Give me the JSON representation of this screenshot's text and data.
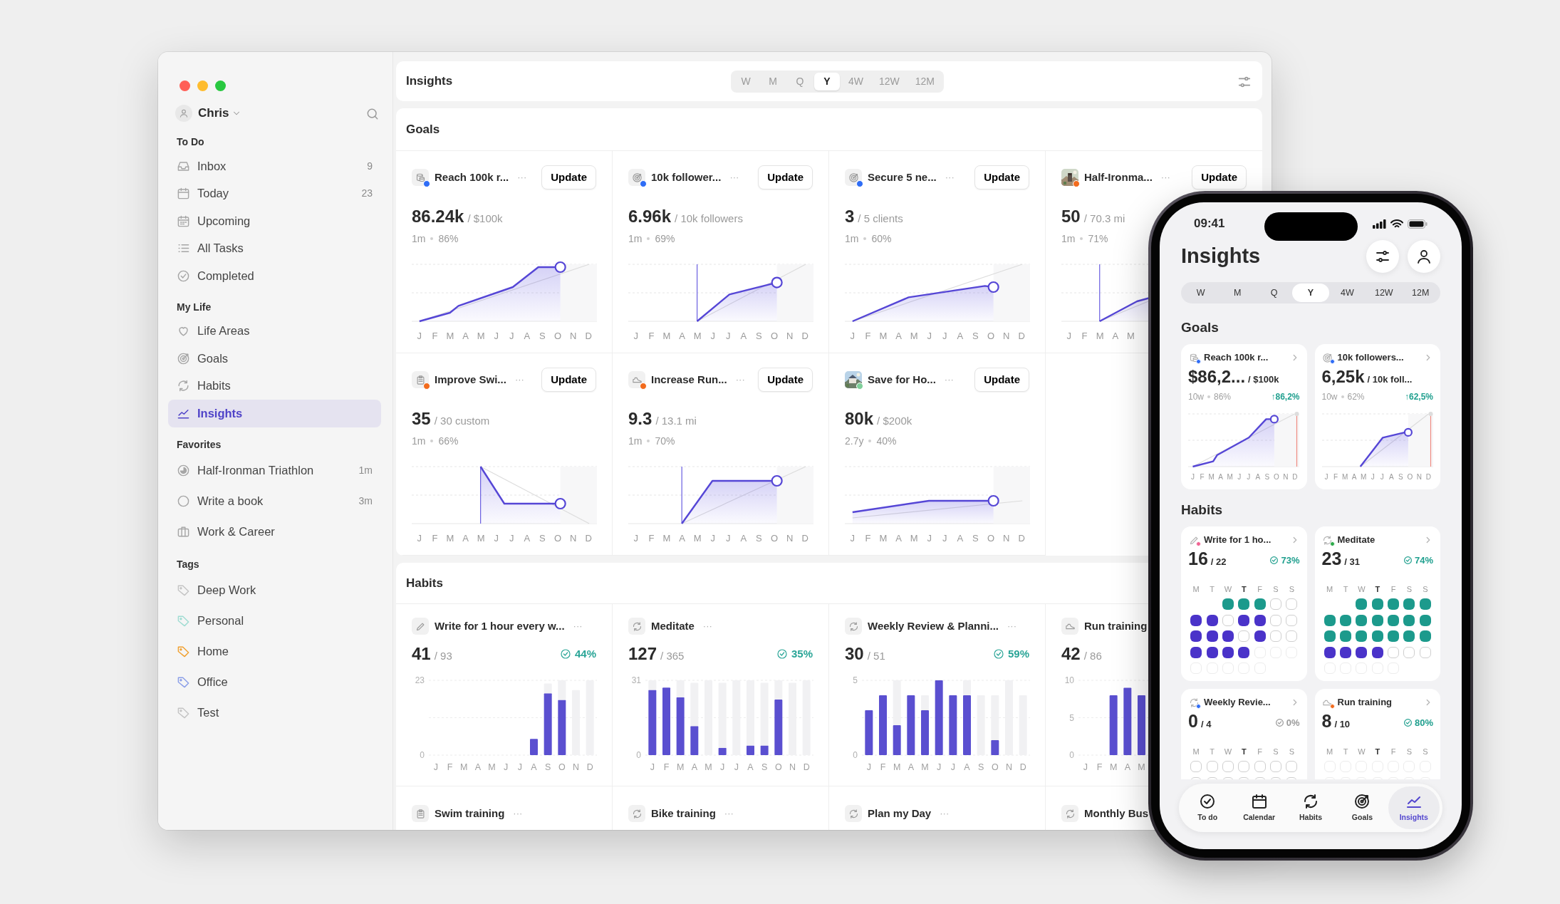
{
  "window": {
    "controls": [
      {
        "color": "#ff5f57"
      },
      {
        "color": "#febc2e"
      },
      {
        "color": "#28c840"
      }
    ]
  },
  "sidebar": {
    "user": {
      "name": "Chris"
    },
    "sections": [
      {
        "title": "To Do",
        "items": [
          {
            "label": "Inbox",
            "count": "9",
            "selected": false
          },
          {
            "label": "Today",
            "count": "23",
            "selected": false
          },
          {
            "label": "Upcoming",
            "selected": false
          },
          {
            "label": "All Tasks",
            "selected": false
          },
          {
            "label": "Completed",
            "selected": false
          }
        ]
      },
      {
        "title": "My Life",
        "items": [
          {
            "label": "Life Areas",
            "selected": false
          },
          {
            "label": "Goals",
            "selected": false
          },
          {
            "label": "Habits",
            "selected": false
          },
          {
            "label": "Insights",
            "selected": true
          }
        ]
      },
      {
        "title": "Favorites",
        "items": [
          {
            "label": "Half-Ironman Triathlon",
            "count": "1m",
            "selected": false
          },
          {
            "label": "Write a book",
            "count": "3m",
            "selected": false
          },
          {
            "label": "Work & Career",
            "selected": false
          }
        ]
      },
      {
        "title": "Tags",
        "items": [
          {
            "label": "Deep Work",
            "color": "#c4c4c4",
            "selected": false
          },
          {
            "label": "Personal",
            "color": "#9fdcd2",
            "selected": false
          },
          {
            "label": "Home",
            "color": "#f0a030",
            "selected": false
          },
          {
            "label": "Office",
            "color": "#8a9ee8",
            "selected": false
          },
          {
            "label": "Test",
            "color": "#c4c4c4",
            "selected": false
          }
        ]
      }
    ]
  },
  "toolbar": {
    "title": "Insights",
    "periods": [
      {
        "label": "W",
        "selected": false
      },
      {
        "label": "M",
        "selected": false
      },
      {
        "label": "Q",
        "selected": false
      },
      {
        "label": "Y",
        "selected": true
      },
      {
        "label": "4W",
        "selected": false
      },
      {
        "label": "12W",
        "selected": false
      },
      {
        "label": "12M",
        "selected": false
      }
    ]
  },
  "goals": {
    "title": "Goals",
    "cards": [
      {
        "title": "Reach 100k r...",
        "color": "#2f6df6",
        "more": "···",
        "button": "Update",
        "value": "86.24k",
        "target": "/ $100k",
        "meta": [
          "1m",
          "86%"
        ],
        "months": [
          "J",
          "F",
          "M",
          "A",
          "M",
          "J",
          "J",
          "A",
          "S",
          "O",
          "N",
          "D"
        ]
      },
      {
        "title": "10k follower...",
        "color": "#2f6df6",
        "more": "···",
        "button": "Update",
        "value": "6.96k",
        "target": "/ 10k followers",
        "meta": [
          "1m",
          "69%"
        ],
        "months": [
          "J",
          "F",
          "M",
          "A",
          "M",
          "J",
          "J",
          "A",
          "S",
          "O",
          "N",
          "D"
        ]
      },
      {
        "title": "Secure 5 ne...",
        "color": "#2f6df6",
        "more": "···",
        "button": "Update",
        "value": "3",
        "target": "/ 5 clients",
        "meta": [
          "1m",
          "60%"
        ],
        "months": [
          "J",
          "F",
          "M",
          "A",
          "M",
          "J",
          "J",
          "A",
          "S",
          "O",
          "N",
          "D"
        ]
      },
      {
        "title": "Half-Ironma...",
        "color": "#f26b1d",
        "more": "···",
        "button": "Update",
        "value": "50",
        "target": "/ 70.3 mi",
        "meta": [
          "1m",
          "71%"
        ],
        "months": [
          "J",
          "F",
          "M",
          "A",
          "M"
        ]
      },
      {
        "title": "Improve Swi...",
        "color": "#f26b1d",
        "more": "···",
        "button": "Update",
        "value": "35",
        "target": "/ 30 custom",
        "meta": [
          "1m",
          "66%"
        ],
        "months": [
          "J",
          "F",
          "M",
          "A",
          "M",
          "J",
          "J",
          "A",
          "S",
          "O",
          "N",
          "D"
        ]
      },
      {
        "title": "Increase Run...",
        "color": "#f26b1d",
        "more": "···",
        "button": "Update",
        "value": "9.3",
        "target": "/ 13.1 mi",
        "meta": [
          "1m",
          "70%"
        ],
        "months": [
          "J",
          "F",
          "M",
          "A",
          "M",
          "J",
          "J",
          "A",
          "S",
          "O",
          "N",
          "D"
        ]
      },
      {
        "title": "Save for Ho...",
        "color": "#7fcf9a",
        "more": "···",
        "button": "Update",
        "value": "80k",
        "target": "/ $200k",
        "meta": [
          "2.7y",
          "40%"
        ],
        "months": [
          "J",
          "F",
          "M",
          "A",
          "M",
          "J",
          "J",
          "A",
          "S",
          "O",
          "N",
          "D"
        ]
      }
    ]
  },
  "habits": {
    "title": "Habits",
    "cards": [
      {
        "kind": "chart",
        "title": "Write for 1 hour every w...",
        "more": "···",
        "value": "41",
        "target": "/ 93",
        "percent": "44%",
        "chart_data": {
          "type": "bar",
          "categories": [
            "J",
            "F",
            "M",
            "A",
            "M",
            "J",
            "J",
            "A",
            "S",
            "O",
            "N",
            "D"
          ],
          "stacked": true,
          "series": [
            {
              "color": "#5a4fd0",
              "values": [
                0,
                0,
                0,
                0,
                0,
                0,
                0,
                5,
                19,
                17,
                0,
                0
              ]
            },
            {
              "color": "#f1f1f3",
              "values": [
                null,
                null,
                null,
                null,
                null,
                null,
                null,
                null,
                3,
                6,
                20,
                23
              ]
            }
          ],
          "ylim": [
            0,
            23
          ],
          "yticks": [
            0,
            23
          ]
        }
      },
      {
        "kind": "chart",
        "title": "Meditate",
        "more": "···",
        "value": "127",
        "target": "/ 365",
        "percent": "35%",
        "chart_data": {
          "type": "bar",
          "categories": [
            "J",
            "F",
            "M",
            "A",
            "M",
            "J",
            "J",
            "A",
            "S",
            "O",
            "N",
            "D"
          ],
          "stacked": true,
          "series": [
            {
              "color": "#5a4fd0",
              "values": [
                27,
                28,
                24,
                12,
                0,
                3,
                0,
                4,
                4,
                23,
                0,
                0
              ]
            },
            {
              "color": "#f1f1f3",
              "values": [
                4,
                null,
                7,
                18,
                31,
                27,
                31,
                27,
                26,
                8,
                30,
                31
              ]
            }
          ],
          "ylim": [
            0,
            31
          ],
          "yticks": [
            0,
            31
          ]
        }
      },
      {
        "kind": "chart",
        "title": "Weekly Review & Planni...",
        "more": "···",
        "value": "30",
        "target": "/ 51",
        "percent": "59%",
        "chart_data": {
          "type": "bar",
          "categories": [
            "J",
            "F",
            "M",
            "A",
            "M",
            "J",
            "J",
            "A",
            "S",
            "O",
            "N",
            "D"
          ],
          "stacked": true,
          "series": [
            {
              "color": "#5a4fd0",
              "values": [
                3,
                4,
                2,
                4,
                3,
                5,
                4,
                4,
                0,
                1,
                0,
                0
              ]
            },
            {
              "color": "#f1f1f3",
              "values": [
                null,
                null,
                3,
                null,
                1,
                null,
                null,
                1,
                4,
                3,
                5,
                4
              ]
            }
          ],
          "ylim": [
            0,
            5
          ],
          "yticks": [
            0,
            5
          ]
        }
      },
      {
        "kind": "chart",
        "title": "Run training",
        "value": "42",
        "target": "/ 86",
        "chart_data": {
          "type": "bar",
          "categories": [
            "J",
            "F",
            "M",
            "A",
            "M"
          ],
          "series": [
            {
              "color": "#5a4fd0",
              "values": [
                0,
                0,
                8,
                9,
                8
              ]
            }
          ],
          "ylim": [
            0,
            10
          ],
          "yticks": [
            0,
            5,
            10
          ]
        }
      },
      {
        "kind": "title_only",
        "title": "Swim training",
        "more": "···"
      },
      {
        "kind": "title_only",
        "title": "Bike training",
        "more": "···"
      },
      {
        "kind": "title_only",
        "title": "Plan my Day",
        "more": "···"
      },
      {
        "kind": "title_only",
        "title": "Monthly Bus"
      }
    ]
  },
  "phone": {
    "status": {
      "time": "09:41"
    },
    "title": "Insights",
    "periods": [
      {
        "label": "W",
        "selected": false
      },
      {
        "label": "M",
        "selected": false
      },
      {
        "label": "Q",
        "selected": false
      },
      {
        "label": "Y",
        "selected": true
      },
      {
        "label": "4W",
        "selected": false
      },
      {
        "label": "12W",
        "selected": false
      },
      {
        "label": "12M",
        "selected": false
      }
    ],
    "goals": {
      "title": "Goals",
      "cards": [
        {
          "title": "Reach 100k r...",
          "color": "#2f6df6",
          "value": "$86,2...",
          "target": "/ $100k",
          "meta": [
            "10w",
            "86%"
          ],
          "change": "↑86,2%",
          "months": [
            "J",
            "F",
            "M",
            "A",
            "M",
            "J",
            "J",
            "A",
            "S",
            "O",
            "N",
            "D"
          ]
        },
        {
          "title": "10k followers...",
          "color": "#2f6df6",
          "value": "6,25k",
          "target": "/ 10k foll...",
          "meta": [
            "10w",
            "62%"
          ],
          "change": "↑62,5%",
          "months": [
            "J",
            "F",
            "M",
            "A",
            "M",
            "J",
            "J",
            "A",
            "S",
            "O",
            "N",
            "D"
          ]
        }
      ]
    },
    "habits": {
      "title": "Habits",
      "cards": [
        {
          "title": "Write for 1 ho...",
          "color": "#f06292",
          "value": "16",
          "target": "/ 22",
          "percent": "73%",
          "positive": true,
          "days": [
            {
              "label": "M",
              "today": false
            },
            {
              "label": "T",
              "today": false
            },
            {
              "label": "W",
              "today": false
            },
            {
              "label": "T",
              "today": true
            },
            {
              "label": "F",
              "today": false
            },
            {
              "label": "S",
              "today": false
            },
            {
              "label": "S",
              "today": false
            }
          ],
          "cells": [
            [
              {
                "kind": "blank"
              },
              {
                "kind": "blank"
              },
              {
                "kind": "done"
              },
              {
                "kind": "done"
              },
              {
                "kind": "done"
              },
              {
                "kind": "open"
              },
              {
                "kind": "open"
              }
            ],
            [
              {
                "kind": "current"
              },
              {
                "kind": "current"
              },
              {
                "kind": "open"
              },
              {
                "kind": "current"
              },
              {
                "kind": "current"
              },
              {
                "kind": "open"
              },
              {
                "kind": "open"
              }
            ],
            [
              {
                "kind": "current"
              },
              {
                "kind": "current"
              },
              {
                "kind": "current"
              },
              {
                "kind": "open"
              },
              {
                "kind": "current"
              },
              {
                "kind": "open"
              },
              {
                "kind": "open"
              }
            ],
            [
              {
                "kind": "current"
              },
              {
                "kind": "current"
              },
              {
                "kind": "current"
              },
              {
                "kind": "current"
              },
              {
                "kind": "faint"
              },
              {
                "kind": "faint"
              },
              {
                "kind": "faint"
              }
            ],
            [
              {
                "kind": "faint"
              },
              {
                "kind": "faint"
              },
              {
                "kind": "faint"
              },
              {
                "kind": "faint"
              },
              {
                "kind": "faint"
              }
            ]
          ]
        },
        {
          "title": "Meditate",
          "color": "#2eaa4a",
          "value": "23",
          "target": "/ 31",
          "percent": "74%",
          "positive": true,
          "days": [
            {
              "label": "M",
              "today": false
            },
            {
              "label": "T",
              "today": false
            },
            {
              "label": "W",
              "today": false
            },
            {
              "label": "T",
              "today": true
            },
            {
              "label": "F",
              "today": false
            },
            {
              "label": "S",
              "today": false
            },
            {
              "label": "S",
              "today": false
            }
          ],
          "cells": [
            [
              {
                "kind": "blank"
              },
              {
                "kind": "blank"
              },
              {
                "kind": "done"
              },
              {
                "kind": "done"
              },
              {
                "kind": "done"
              },
              {
                "kind": "done"
              },
              {
                "kind": "done"
              }
            ],
            [
              {
                "kind": "done"
              },
              {
                "kind": "done"
              },
              {
                "kind": "done"
              },
              {
                "kind": "done"
              },
              {
                "kind": "done"
              },
              {
                "kind": "done"
              },
              {
                "kind": "done"
              }
            ],
            [
              {
                "kind": "done"
              },
              {
                "kind": "done"
              },
              {
                "kind": "done"
              },
              {
                "kind": "done"
              },
              {
                "kind": "done"
              },
              {
                "kind": "done"
              },
              {
                "kind": "done"
              }
            ],
            [
              {
                "kind": "current"
              },
              {
                "kind": "current"
              },
              {
                "kind": "current"
              },
              {
                "kind": "current"
              },
              {
                "kind": "open"
              },
              {
                "kind": "open"
              },
              {
                "kind": "open"
              }
            ],
            [
              {
                "kind": "faint"
              },
              {
                "kind": "faint"
              },
              {
                "kind": "faint"
              },
              {
                "kind": "faint"
              },
              {
                "kind": "faint"
              }
            ]
          ]
        },
        {
          "title": "Weekly Revie...",
          "color": "#2f6df6",
          "value": "0",
          "target": "/ 4",
          "percent": "0%",
          "positive": false,
          "days": [
            {
              "label": "M",
              "today": false
            },
            {
              "label": "T",
              "today": false
            },
            {
              "label": "W",
              "today": false
            },
            {
              "label": "T",
              "today": true
            },
            {
              "label": "F",
              "today": false
            },
            {
              "label": "S",
              "today": false
            },
            {
              "label": "S",
              "today": false
            }
          ],
          "cells": [
            [
              {
                "kind": "open"
              },
              {
                "kind": "open"
              },
              {
                "kind": "open"
              },
              {
                "kind": "open"
              },
              {
                "kind": "open"
              },
              {
                "kind": "open"
              },
              {
                "kind": "open"
              }
            ],
            [
              {
                "kind": "open"
              },
              {
                "kind": "open"
              },
              {
                "kind": "open"
              },
              {
                "kind": "open"
              },
              {
                "kind": "open"
              },
              {
                "kind": "open"
              },
              {
                "kind": "open"
              }
            ]
          ]
        },
        {
          "title": "Run training",
          "color": "#f26b1d",
          "value": "8",
          "target": "/ 10",
          "percent": "80%",
          "positive": true,
          "days": [
            {
              "label": "M",
              "today": false
            },
            {
              "label": "T",
              "today": false
            },
            {
              "label": "W",
              "today": false
            },
            {
              "label": "T",
              "today": true
            },
            {
              "label": "F",
              "today": false
            },
            {
              "label": "S",
              "today": false
            },
            {
              "label": "S",
              "today": false
            }
          ],
          "cells": [
            [
              {
                "kind": "faint"
              },
              {
                "kind": "faint"
              },
              {
                "kind": "faint"
              },
              {
                "kind": "faint"
              },
              {
                "kind": "faint"
              },
              {
                "kind": "faint"
              },
              {
                "kind": "faint"
              }
            ],
            [
              {
                "kind": "faint"
              },
              {
                "kind": "faint"
              },
              {
                "kind": "faint"
              },
              {
                "kind": "faint"
              },
              {
                "kind": "faint"
              },
              {
                "kind": "faint"
              },
              {
                "kind": "faint"
              }
            ]
          ]
        }
      ]
    },
    "tabs": [
      {
        "label": "To do",
        "selected": false
      },
      {
        "label": "Calendar",
        "selected": false
      },
      {
        "label": "Habits",
        "selected": false
      },
      {
        "label": "Goals",
        "selected": false
      },
      {
        "label": "Insights",
        "selected": true
      }
    ]
  }
}
